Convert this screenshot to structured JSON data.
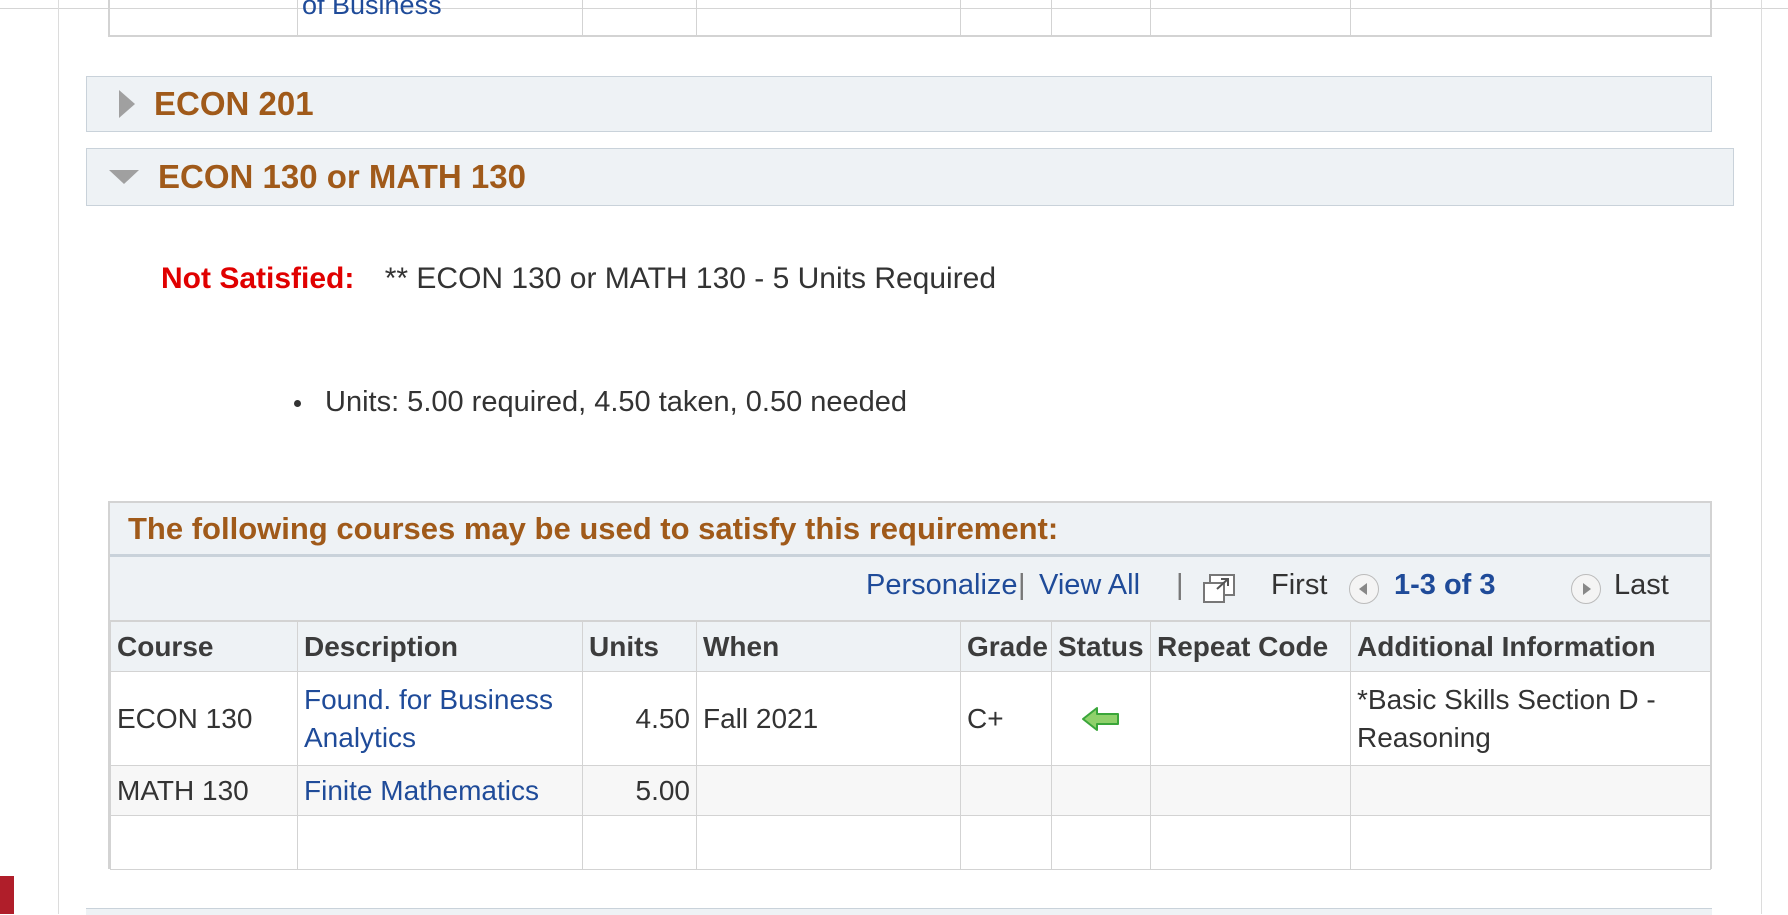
{
  "prev_table": {
    "truncated_text": "of Business"
  },
  "groups": [
    {
      "title": "ECON 201",
      "expanded": false
    },
    {
      "title": "ECON 130 or MATH 130",
      "expanded": true
    }
  ],
  "requirement": {
    "status_label": "Not Satisfied:",
    "status_text": "** ECON 130 or MATH 130 - 5 Units Required",
    "units_text": "Units: 5.00 required, 4.50 taken, 0.50 needed"
  },
  "grid": {
    "title": "The following courses may be used to satisfy this requirement:",
    "nav": {
      "personalize": "Personalize",
      "sep": "|",
      "view_all": "View All",
      "first": "First",
      "count": "1-3 of 3",
      "last": "Last"
    },
    "columns": [
      "Course",
      "Description",
      "Units",
      "When",
      "Grade",
      "Status",
      "Repeat Code",
      "Additional Information"
    ],
    "rows": [
      {
        "course": "ECON 130",
        "description": "Found. for Business Analytics",
        "units": "4.50",
        "when": "Fall 2021",
        "grade": "C+",
        "status_icon": "green-left-arrow-icon",
        "repeat_code": "",
        "additional_info": "*Basic Skills Section D - Reasoning"
      },
      {
        "course": "MATH 130",
        "description": "Finite Mathematics",
        "units": "5.00",
        "when": "",
        "grade": "",
        "status_icon": "",
        "repeat_code": "",
        "additional_info": ""
      },
      {
        "course": "",
        "description": "",
        "units": "",
        "when": "",
        "grade": "",
        "status_icon": "",
        "repeat_code": "",
        "additional_info": ""
      }
    ]
  },
  "colors": {
    "accent_orange": "#a05a1a",
    "link_blue": "#1f4b99",
    "error_red": "#e00000",
    "status_green": "#3aa63a"
  }
}
